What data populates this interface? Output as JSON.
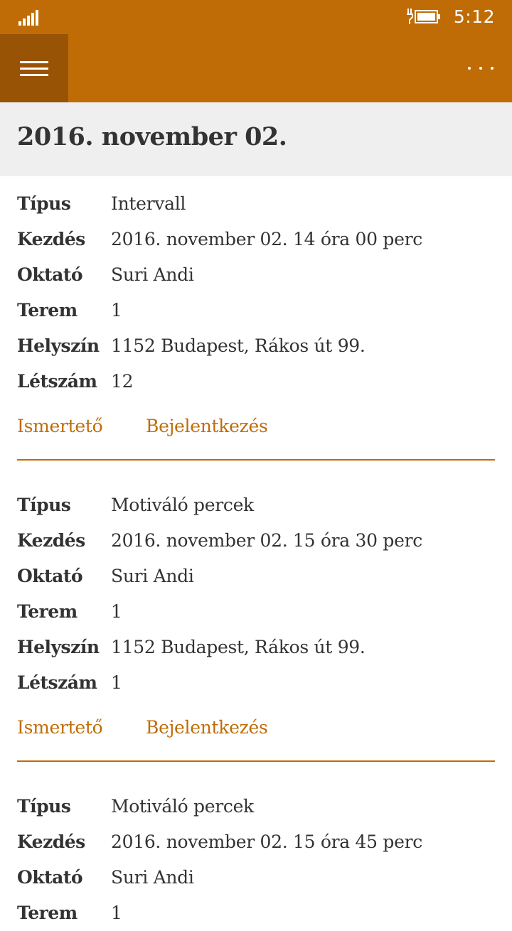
{
  "status_bar": {
    "time": "5:12",
    "signal_icon": "signal-bars-icon",
    "battery_icon": "battery-charging-icon"
  },
  "app_bar": {
    "menu_icon": "hamburger-menu-icon",
    "more_icon": "more-options-icon",
    "accent_color": "#c06c06",
    "menu_button_color": "#995304"
  },
  "page": {
    "date_title": "2016. november 02."
  },
  "labels": {
    "type": "Típus",
    "start": "Kezdés",
    "instructor": "Oktató",
    "room": "Terem",
    "location": "Helyszín",
    "headcount": "Létszám",
    "description_link": "Ismertető",
    "register_link": "Bejelentkezés"
  },
  "sessions": [
    {
      "type": "Intervall",
      "start": "2016. november 02. 14 óra 00 perc",
      "instructor": "Suri Andi",
      "room": "1",
      "location": "1152 Budapest, Rákos út 99.",
      "headcount": "12"
    },
    {
      "type": "Motiváló percek",
      "start": "2016. november 02. 15 óra 30 perc",
      "instructor": "Suri Andi",
      "room": "1",
      "location": "1152 Budapest, Rákos út 99.",
      "headcount": "1"
    },
    {
      "type": "Motiváló percek",
      "start": "2016. november 02. 15 óra 45 perc",
      "instructor": "Suri Andi",
      "room": "1"
    }
  ]
}
